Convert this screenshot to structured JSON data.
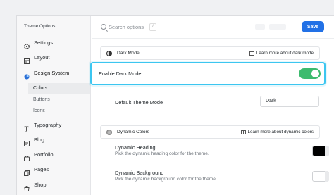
{
  "sidebar": {
    "title": "Theme Options",
    "items": [
      {
        "label": "Settings",
        "icon": "gear-icon"
      },
      {
        "label": "Layout",
        "icon": "layout-icon"
      },
      {
        "label": "Design System",
        "icon": "design-system-icon"
      },
      {
        "label": "Typography",
        "icon": "typography-icon"
      },
      {
        "label": "Blog",
        "icon": "blog-icon"
      },
      {
        "label": "Portfolio",
        "icon": "portfolio-icon"
      },
      {
        "label": "Pages",
        "icon": "pages-icon"
      },
      {
        "label": "Shop",
        "icon": "shop-icon"
      }
    ],
    "subitems": [
      {
        "label": "Colors"
      },
      {
        "label": "Buttons"
      },
      {
        "label": "Icons"
      }
    ]
  },
  "topbar": {
    "search_placeholder": "Search options",
    "shortcut": "/",
    "save_label": "Save"
  },
  "dark_mode_section": {
    "title": "Dark Mode",
    "learn_more": "Learn more about dark mode",
    "enable_label": "Enable Dark Mode",
    "enabled": true,
    "default_theme_label": "Default Theme Mode",
    "default_theme_value": "Dark"
  },
  "dynamic_colors_section": {
    "title": "Dynamic Colors",
    "learn_more": "Learn more about dynamic colors",
    "heading_label": "Dynamic Heading",
    "heading_desc": "Pick the dynamic heading color for the theme.",
    "heading_color": "#000000",
    "background_label": "Dynamic Background",
    "background_desc": "Pick the dynamic background color for the theme.",
    "background_color": "#ffffff"
  },
  "colors": {
    "accent": "#2271e6",
    "toggle_on": "#3dbb6e",
    "highlight": "#3cc6f0"
  }
}
